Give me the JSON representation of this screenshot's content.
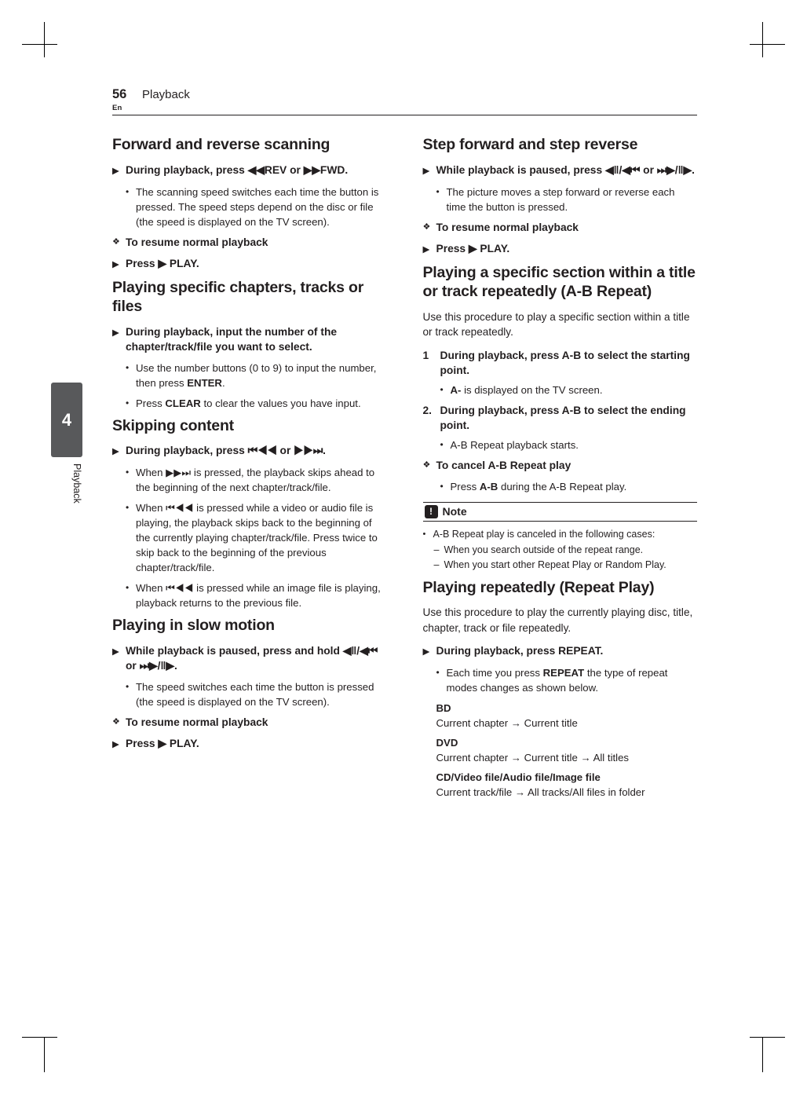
{
  "header": {
    "page_number": "56",
    "section": "Playback",
    "language": "En"
  },
  "chapter_tab": {
    "number": "4",
    "label": "Playback"
  },
  "left_column": {
    "s1": {
      "title": "Forward and reverse scanning",
      "arrow1": "During playback, press ◀◀REV or ▶▶FWD.",
      "bullet1": "The scanning speed switches each time the button is pressed. The speed steps depend on the disc or file (the speed is displayed on the TV screen).",
      "diamond1": "To resume normal playback",
      "arrow2": "Press ▶ PLAY."
    },
    "s2": {
      "title": "Playing specific chapters, tracks or files",
      "arrow1": "During playback, input the number of the chapter/track/file you want to select.",
      "bullet1_a": "Use the number buttons (0 to 9) to input the number, then press ",
      "bullet1_b": "ENTER",
      "bullet1_c": ".",
      "bullet2_a": "Press ",
      "bullet2_b": "CLEAR",
      "bullet2_c": " to clear the values you have input."
    },
    "s3": {
      "title": "Skipping content",
      "arrow1": "During playback, press ⏮◀◀ or ▶▶⏭.",
      "bullet1": "When ▶▶⏭ is pressed, the playback skips ahead to the beginning of the next chapter/track/file.",
      "bullet2": "When ⏮◀◀ is pressed while a video or audio file is playing, the playback skips back to the beginning of the currently playing chapter/track/file. Press twice to skip back to the beginning of the previous chapter/track/file.",
      "bullet3": "When ⏮◀◀ is pressed while an image file is playing, playback returns to the previous file."
    },
    "s4": {
      "title": "Playing in slow motion",
      "arrow1": "While playback is paused, press and hold ◀‖/◀⏮ or ⏭▶/‖▶.",
      "bullet1": "The speed switches each time the button is pressed (the speed is displayed on the TV screen).",
      "diamond1": "To resume normal playback",
      "arrow2": "Press ▶ PLAY."
    }
  },
  "right_column": {
    "s1": {
      "title": "Step forward and step reverse",
      "arrow1": "While playback is paused, press ◀‖/◀⏮ or ⏭▶/‖▶.",
      "bullet1": "The picture moves a step forward or reverse each time the button is pressed.",
      "diamond1": "To resume normal playback",
      "arrow2": "Press ▶ PLAY."
    },
    "s2": {
      "title": "Playing a specific section within a title or track repeatedly (A-B Repeat)",
      "para1": "Use this procedure to play a specific section within a title or track repeatedly.",
      "step1_num": "1",
      "step1_text": "During playback, press A-B to select the starting point.",
      "step1_bullet_a": "A-",
      "step1_bullet_b": " is displayed on the TV screen.",
      "step2_num": "2.",
      "step2_text": "During playback, press A-B to select the ending point.",
      "step2_bullet": "A-B Repeat playback starts.",
      "diamond1": "To cancel A-B Repeat play",
      "cancel_bullet_a": "Press ",
      "cancel_bullet_b": "A-B",
      "cancel_bullet_c": " during the A-B Repeat play.",
      "note": {
        "title": "Note",
        "icon": "exclamation-icon",
        "bullet1": "A-B Repeat play is canceled in the following cases:",
        "dash1": "When you search outside of the repeat range.",
        "dash2": "When you start other Repeat Play or Random Play."
      }
    },
    "s3": {
      "title": "Playing repeatedly (Repeat Play)",
      "para1": "Use this procedure to play the currently playing disc, title, chapter, track or file repeatedly.",
      "arrow1": "During playback, press REPEAT.",
      "bullet1_a": "Each time you press ",
      "bullet1_b": "REPEAT",
      "bullet1_c": " the type of repeat modes changes as shown below.",
      "modes": [
        {
          "label": "BD",
          "text": "Current chapter → Current title"
        },
        {
          "label": "DVD",
          "text": "Current chapter → Current title → All titles"
        },
        {
          "label": "CD/Video file/Audio file/Image file",
          "text": "Current track/file → All tracks/All files in folder"
        }
      ]
    }
  },
  "glyphs": {
    "arrow_bullet": "▶",
    "diamond_bullet": "❖",
    "round_bullet": "•",
    "dash_bullet": "–"
  }
}
